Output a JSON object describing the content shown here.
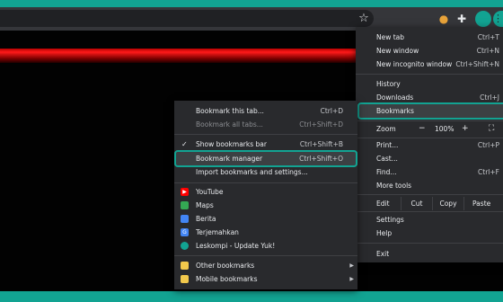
{
  "toolbar": {
    "star_icon": "star-icon",
    "extensions": [
      "cookie-icon",
      "puzzle-icon"
    ],
    "menu_icon": "kebab-menu-icon"
  },
  "main_menu": {
    "new_tab": {
      "label": "New tab",
      "shortcut": "Ctrl+T"
    },
    "new_window": {
      "label": "New window",
      "shortcut": "Ctrl+N"
    },
    "new_incognito": {
      "label": "New incognito window",
      "shortcut": "Ctrl+Shift+N"
    },
    "history": {
      "label": "History"
    },
    "downloads": {
      "label": "Downloads",
      "shortcut": "Ctrl+J"
    },
    "bookmarks": {
      "label": "Bookmarks"
    },
    "zoom": {
      "label": "Zoom",
      "minus": "−",
      "value": "100%",
      "plus": "+"
    },
    "print": {
      "label": "Print...",
      "shortcut": "Ctrl+P"
    },
    "cast": {
      "label": "Cast..."
    },
    "find": {
      "label": "Find...",
      "shortcut": "Ctrl+F"
    },
    "more_tools": {
      "label": "More tools"
    },
    "edit": {
      "label": "Edit",
      "cut": "Cut",
      "copy": "Copy",
      "paste": "Paste"
    },
    "settings": {
      "label": "Settings"
    },
    "help": {
      "label": "Help"
    },
    "exit": {
      "label": "Exit"
    }
  },
  "bookmarks_menu": {
    "bookmark_tab": {
      "label": "Bookmark this tab...",
      "shortcut": "Ctrl+D"
    },
    "bookmark_all": {
      "label": "Bookmark all tabs...",
      "shortcut": "Ctrl+Shift+D"
    },
    "show_bar": {
      "label": "Show bookmarks bar",
      "shortcut": "Ctrl+Shift+B"
    },
    "manager": {
      "label": "Bookmark manager",
      "shortcut": "Ctrl+Shift+O"
    },
    "import": {
      "label": "Import bookmarks and settings..."
    },
    "items": [
      {
        "label": "YouTube",
        "icon": "youtube-icon",
        "color": "#ff0000"
      },
      {
        "label": "Maps",
        "icon": "maps-icon",
        "color": "#34a853"
      },
      {
        "label": "Berita",
        "icon": "news-icon",
        "color": "#4285f4"
      },
      {
        "label": "Terjemahkan",
        "icon": "translate-icon",
        "color": "#4285f4"
      },
      {
        "label": "Leskompi - Update Yuk!",
        "icon": "leskompi-icon",
        "color": "#12a392"
      }
    ],
    "other": {
      "label": "Other bookmarks"
    },
    "mobile": {
      "label": "Mobile bookmarks"
    }
  },
  "colors": {
    "accent": "#12a392",
    "menu_bg": "#292a2d",
    "highlight": "#3c4043"
  }
}
